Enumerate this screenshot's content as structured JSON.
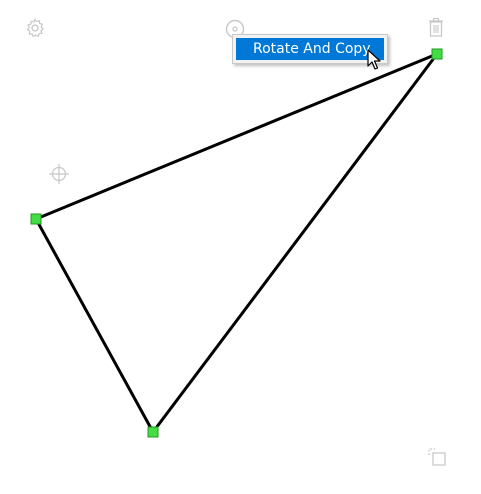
{
  "toolbar": {
    "settings_icon": "gear-icon",
    "rotate_icon": "rotate-handle-icon",
    "delete_icon": "trash-icon",
    "center_icon": "crosshair-icon",
    "copy_icon": "copy-icon"
  },
  "context_menu": {
    "items": [
      {
        "label": "Rotate And Copy"
      }
    ]
  },
  "shape": {
    "type": "triangle",
    "stroke_color": "#000000",
    "handle_color": "#44dd44",
    "vertex_count": 3
  },
  "colors": {
    "menu_highlight": "#0078d7",
    "icon_gray": "#c8c8c8"
  }
}
